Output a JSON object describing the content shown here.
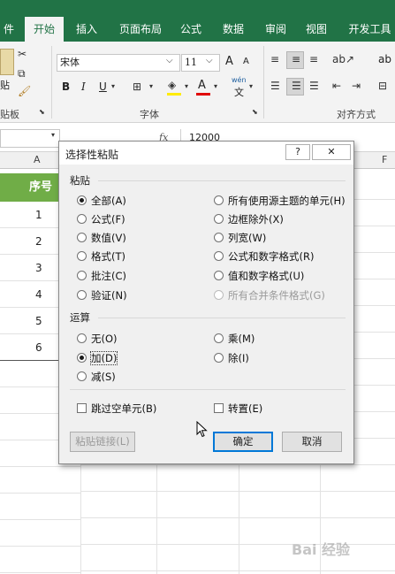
{
  "ribbon": {
    "tabs": [
      {
        "label": "件"
      },
      {
        "label": "开始"
      },
      {
        "label": "插入"
      },
      {
        "label": "页面布局"
      },
      {
        "label": "公式"
      },
      {
        "label": "数据"
      },
      {
        "label": "审阅"
      },
      {
        "label": "视图"
      },
      {
        "label": "开发工具"
      }
    ],
    "clipboard_label": "贴板",
    "paste_label": "贴",
    "font_group_label": "字体",
    "align_group_label": "对齐方式",
    "font_name": "宋体",
    "font_size": "11",
    "bold": "B",
    "italic": "I",
    "underline": "U",
    "grow_font": "A",
    "shrink_font": "A",
    "font_color": "A",
    "wen": "wén",
    "wen_char": "文",
    "wrap_label": "ab"
  },
  "formula_bar": {
    "fx": "fx",
    "value": "12000"
  },
  "sheet": {
    "col_a": "A",
    "col_f": "F",
    "header": "序号",
    "rows": [
      "1",
      "2",
      "3",
      "4",
      "5",
      "6"
    ]
  },
  "dialog": {
    "title": "选择性粘贴",
    "help": "?",
    "close": "✕",
    "paste_section": "粘贴",
    "paste_left": [
      {
        "label": "全部(A)",
        "checked": true
      },
      {
        "label": "公式(F)"
      },
      {
        "label": "数值(V)"
      },
      {
        "label": "格式(T)"
      },
      {
        "label": "批注(C)"
      },
      {
        "label": "验证(N)"
      }
    ],
    "paste_right": [
      {
        "label": "所有使用源主题的单元(H)"
      },
      {
        "label": "边框除外(X)"
      },
      {
        "label": "列宽(W)"
      },
      {
        "label": "公式和数字格式(R)"
      },
      {
        "label": "值和数字格式(U)"
      },
      {
        "label": "所有合并条件格式(G)",
        "disabled": true
      }
    ],
    "op_section": "运算",
    "op_left": [
      {
        "label": "无(O)"
      },
      {
        "label": "加(D)",
        "checked": true
      },
      {
        "label": "减(S)"
      }
    ],
    "op_right": [
      {
        "label": "乘(M)"
      },
      {
        "label": "除(I)"
      }
    ],
    "skip_blanks": "跳过空单元(B)",
    "transpose": "转置(E)",
    "paste_link": "粘贴链接(L)",
    "ok": "确定",
    "cancel": "取消"
  },
  "watermark": "Bai 经验"
}
